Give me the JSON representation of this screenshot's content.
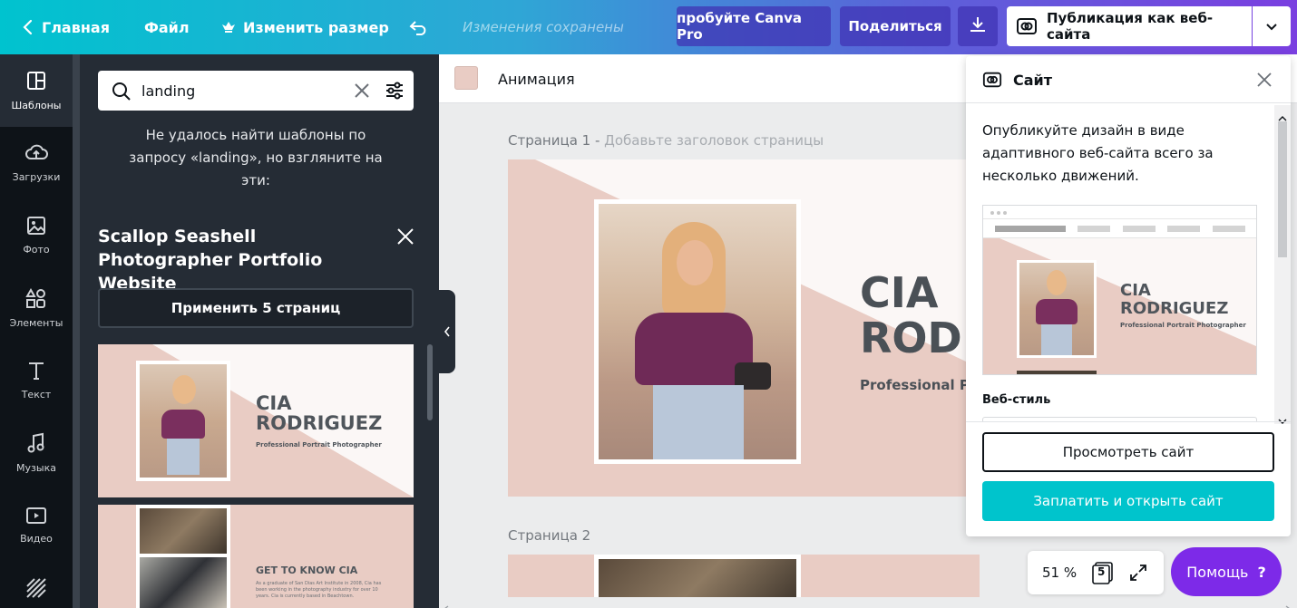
{
  "topbar": {
    "home_label": "Главная",
    "file_label": "Файл",
    "resize_label": "Изменить размер",
    "status": "Изменения сохранены",
    "try_pro_label": "пробуйте Canva Pro",
    "share_label": "Поделиться",
    "publish_label": "Публикация как веб-сайта"
  },
  "rail": {
    "items": [
      {
        "label": "Шаблоны",
        "icon": "templates-icon"
      },
      {
        "label": "Загрузки",
        "icon": "upload-icon"
      },
      {
        "label": "Фото",
        "icon": "photo-icon"
      },
      {
        "label": "Элементы",
        "icon": "elements-icon"
      },
      {
        "label": "Текст",
        "icon": "text-icon"
      },
      {
        "label": "Музыка",
        "icon": "music-icon"
      },
      {
        "label": "Видео",
        "icon": "video-icon"
      }
    ]
  },
  "panel": {
    "search_value": "landing",
    "not_found": "Не удалось найти шаблоны по запросу «landing», но взгляните на эти:",
    "template_title": "Scallop Seashell Photographer Portfolio Website",
    "apply_label": "Применить 5 страниц",
    "thumb1": {
      "name_line1": "CIA",
      "name_line2": "RODRIGUEZ",
      "subtitle": "Professional Portrait Photographer"
    },
    "thumb2": {
      "heading": "GET TO KNOW CIA",
      "body": "As a graduate of San Dias Art Institute in 2008, Cia has been working in the photography industry for over 10 years. Cia is currently based in Beachtown."
    }
  },
  "canvas": {
    "animation_label": "Анимация",
    "page1_label": "Страница 1 -",
    "page1_sub": "Добавьте заголовок страницы",
    "page2_label": "Страница 2",
    "hero_line1": "CIA",
    "hero_line2": "ROD",
    "hero_sub": "Professional Po"
  },
  "site_panel": {
    "title": "Сайт",
    "description": "Опубликуйте дизайн в виде адаптивного веб-сайта всего за несколько движений.",
    "preview": {
      "name_line1": "CIA",
      "name_line2": "RODRIGUEZ",
      "subtitle": "Professional Portrait Photographer"
    },
    "web_style_label": "Веб-стиль",
    "view_site_label": "Просмотреть сайт",
    "pay_open_label": "Заплатить и открыть сайт"
  },
  "zoom": {
    "value": "51 %",
    "page_count": "5"
  },
  "help": {
    "label": "Помощь",
    "mark": "?"
  },
  "colors": {
    "accent": "#00c4cc",
    "help": "#7d2ae8",
    "pink": "#e9ccc4",
    "dark": "#252c35"
  }
}
